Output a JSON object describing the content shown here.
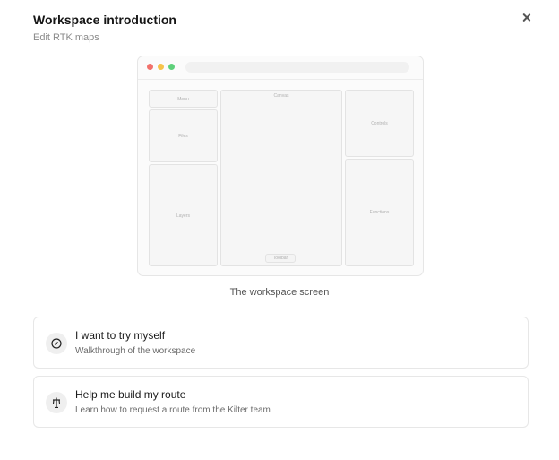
{
  "dialog": {
    "title": "Workspace introduction",
    "subtitle": "Edit RTK maps",
    "close_icon": "close-icon"
  },
  "preview": {
    "panels": {
      "menu": "Menu",
      "files": "Files",
      "layers": "Layers",
      "canvas": "Canvas",
      "toolbar": "Toolbar",
      "controls": "Controls",
      "functions": "Functions"
    },
    "caption": "The workspace screen"
  },
  "options": [
    {
      "title": "I want to try myself",
      "description": "Walkthrough of the workspace",
      "icon": "compass-icon"
    },
    {
      "title": "Help me build my route",
      "description": "Learn how to request a route from the Kilter team",
      "icon": "route-sign-icon"
    }
  ]
}
